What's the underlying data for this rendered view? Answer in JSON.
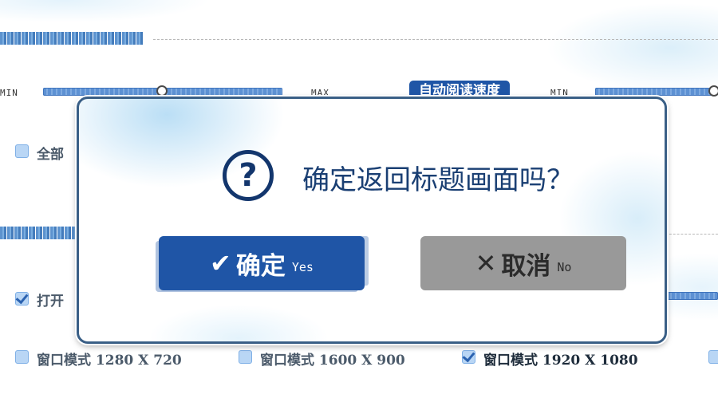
{
  "settings": {
    "slider1": {
      "min_label": "MIN",
      "max_label": "MAX",
      "value": 0.5
    },
    "slider2": {
      "tag": "自动阅读速度",
      "min_label": "MIN",
      "value": 1.0
    },
    "all_option_label": "全部",
    "open_option_label": "打开",
    "resolutions": [
      {
        "label": "窗口模式 1280 X 720",
        "checked": false
      },
      {
        "label": "窗口模式 1600 X 900",
        "checked": false
      },
      {
        "label": "窗口模式 1920 X 1080",
        "checked": true
      }
    ]
  },
  "dialog": {
    "icon": "question-circle-icon",
    "question": "确定返回标题画面吗？",
    "confirm": {
      "icon": "check-icon",
      "label": "确定",
      "sub": "Yes"
    },
    "cancel": {
      "icon": "close-icon",
      "label": "取消",
      "sub": "No"
    }
  },
  "colors": {
    "accent": "#1f55a6",
    "dialog_text": "#1a3f73",
    "cancel_bg": "#999999",
    "border": "#3a5f86"
  }
}
